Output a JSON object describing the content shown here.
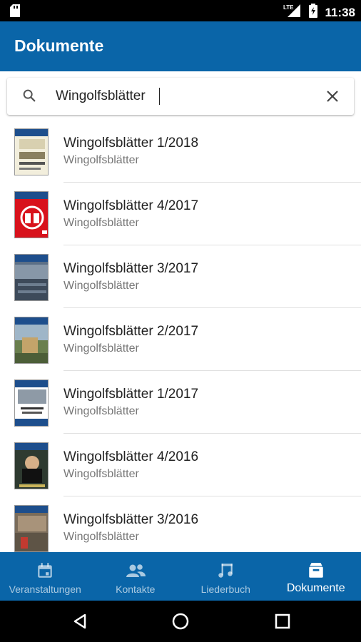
{
  "status_bar": {
    "time": "11:38",
    "network": "LTE"
  },
  "app_bar": {
    "title": "Dokumente"
  },
  "search": {
    "value": "Wingolfsblätter",
    "placeholder": ""
  },
  "documents": [
    {
      "title": "Wingolfsblätter 1/2018",
      "subtitle": "Wingolfsblätter"
    },
    {
      "title": "Wingolfsblätter 4/2017",
      "subtitle": "Wingolfsblätter"
    },
    {
      "title": "Wingolfsblätter 3/2017",
      "subtitle": "Wingolfsblätter"
    },
    {
      "title": "Wingolfsblätter 2/2017",
      "subtitle": "Wingolfsblätter"
    },
    {
      "title": "Wingolfsblätter 1/2017",
      "subtitle": "Wingolfsblätter"
    },
    {
      "title": "Wingolfsblätter 4/2016",
      "subtitle": "Wingolfsblätter"
    },
    {
      "title": "Wingolfsblätter 3/2016",
      "subtitle": "Wingolfsblätter"
    }
  ],
  "bottom_nav": [
    {
      "label": "Veranstaltungen",
      "icon": "calendar-icon",
      "active": false
    },
    {
      "label": "Kontakte",
      "icon": "people-icon",
      "active": false
    },
    {
      "label": "Liederbuch",
      "icon": "music-note-icon",
      "active": false
    },
    {
      "label": "Dokumente",
      "icon": "archive-icon",
      "active": true
    }
  ],
  "colors": {
    "primary": "#0a65a8",
    "status_bar": "#000000",
    "text_primary": "#222222",
    "text_secondary": "#777777"
  }
}
